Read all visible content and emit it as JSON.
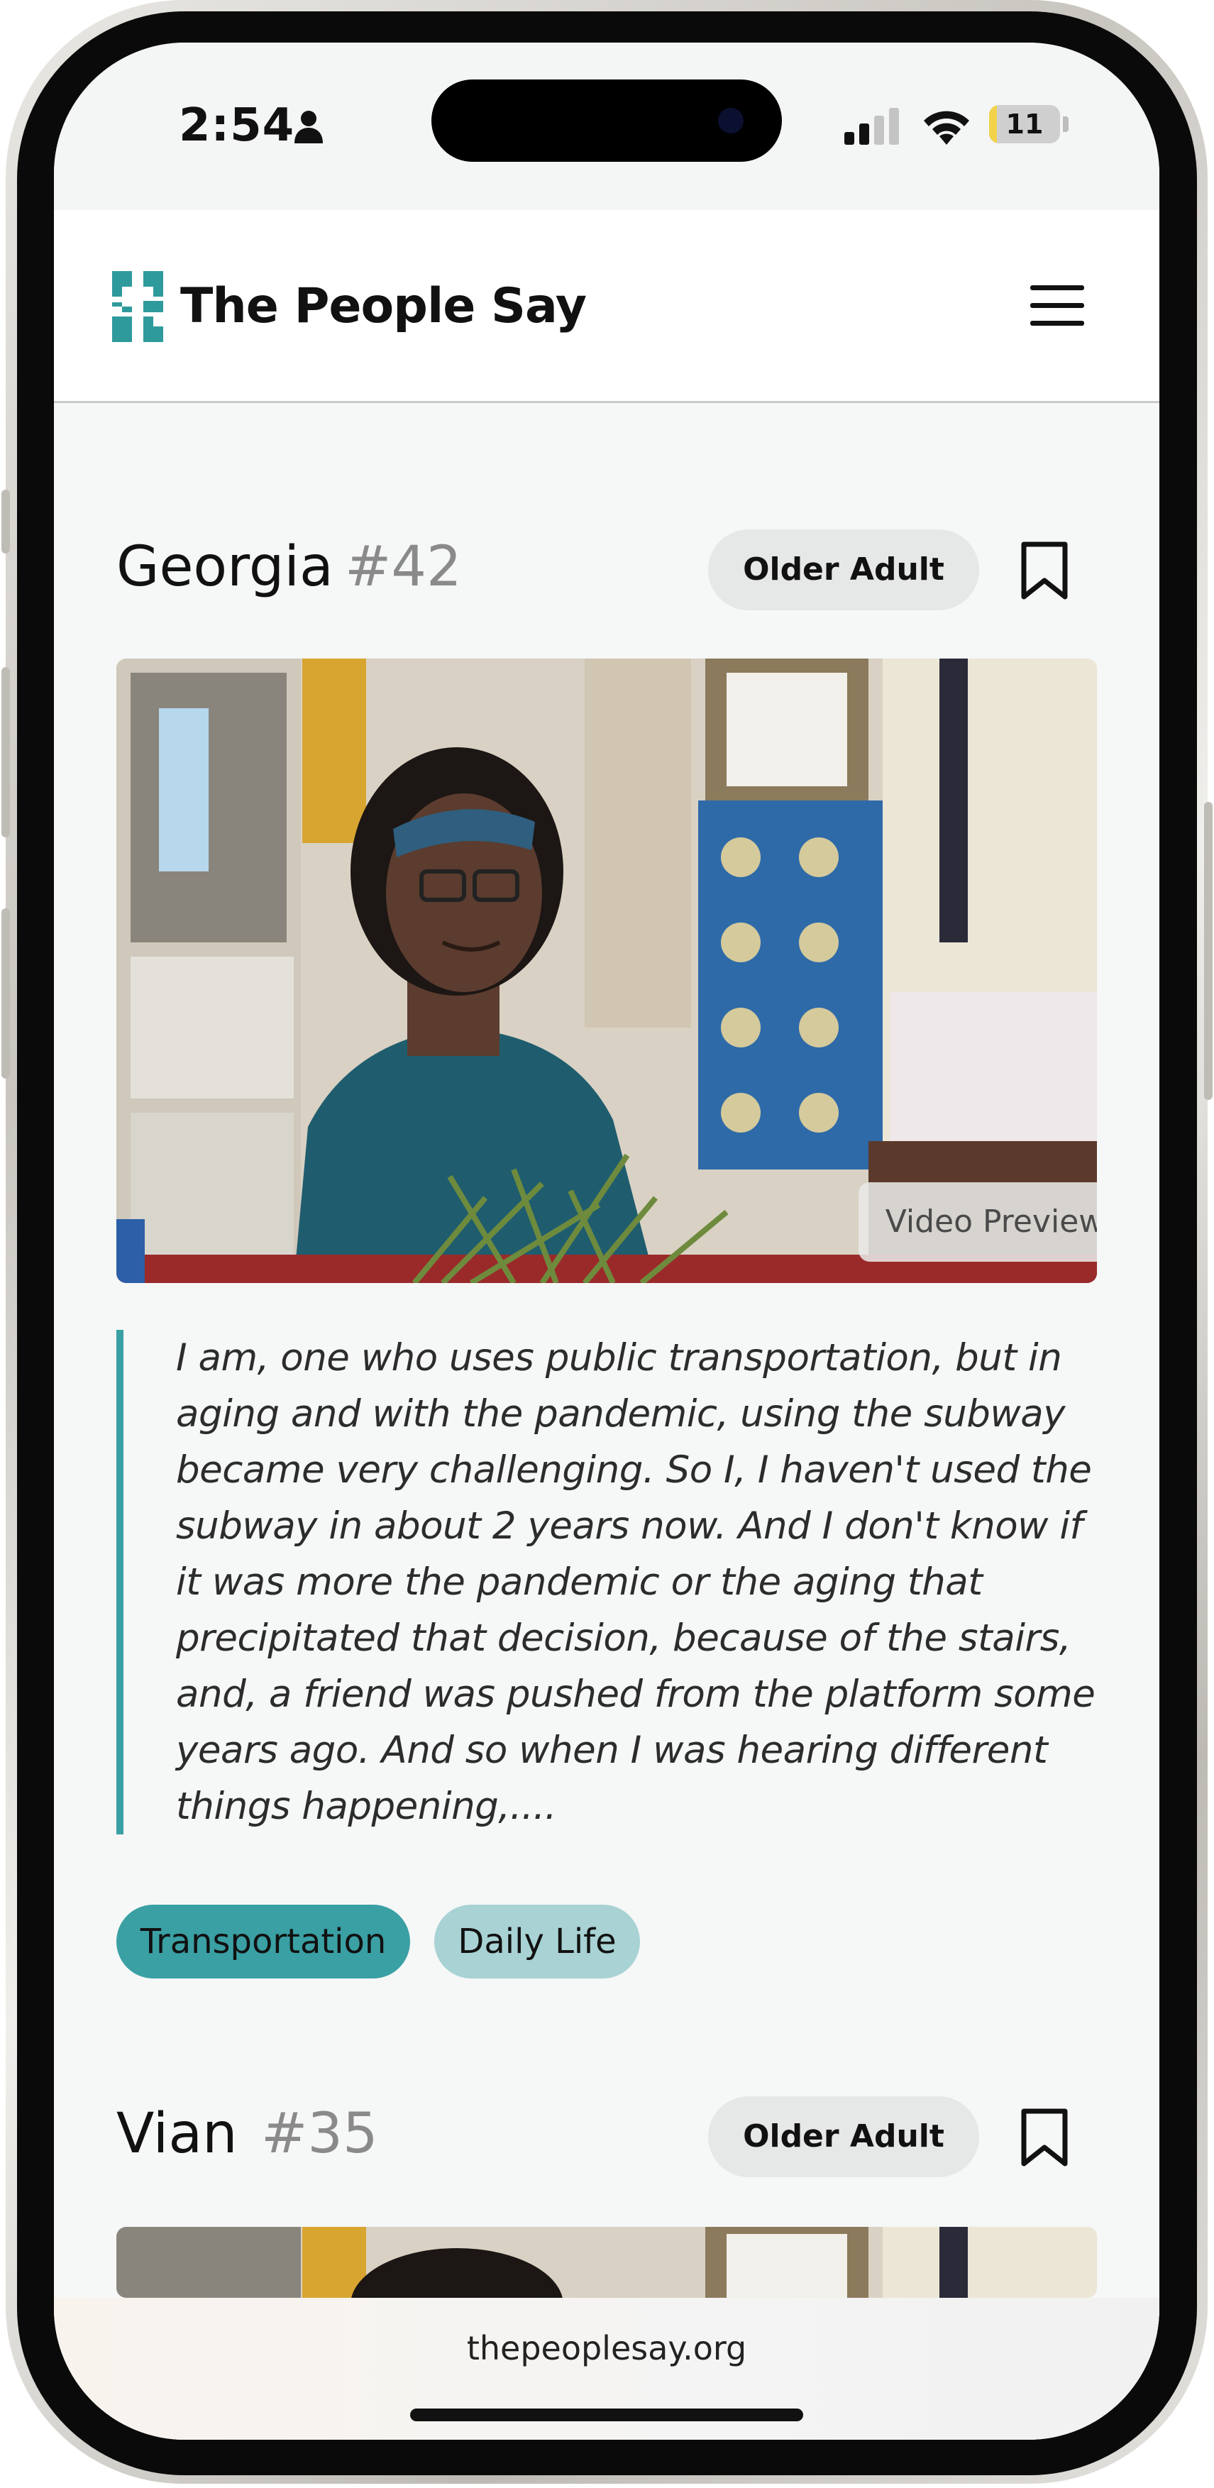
{
  "status_bar": {
    "time": "2:54",
    "battery": "11",
    "battery_level": 0.11,
    "icons": [
      "person-icon",
      "cellular-signal-icon",
      "wifi-icon",
      "battery-icon"
    ]
  },
  "header": {
    "brand": "The People Say",
    "menu_icon": "hamburger-menu-icon"
  },
  "colors": {
    "accent": "#3aa0a4",
    "accent_light": "#a8d2d4",
    "badge_bg": "#e6e7e7",
    "card_bg": "#f6f7f7"
  },
  "stories": [
    {
      "name": "Georgia",
      "number": "#42",
      "badge": "Older Adult",
      "video_label": "Video Preview",
      "quote": "I am, one who uses public transportation, but in aging and with the pandemic, using the subway became very challenging. So I, I haven't used the subway in about 2 years now. And I don't know if it was more the pandemic or the aging that precipitated that decision, because of the stairs, and, a friend was pushed from the platform some years ago. And so when I was hearing different things happening,....",
      "tags": [
        "Transportation",
        "Daily Life"
      ]
    },
    {
      "name": "Vian",
      "number": "#35",
      "badge": "Older Adult"
    }
  ],
  "browser": {
    "url": "thepeoplesay.org"
  }
}
